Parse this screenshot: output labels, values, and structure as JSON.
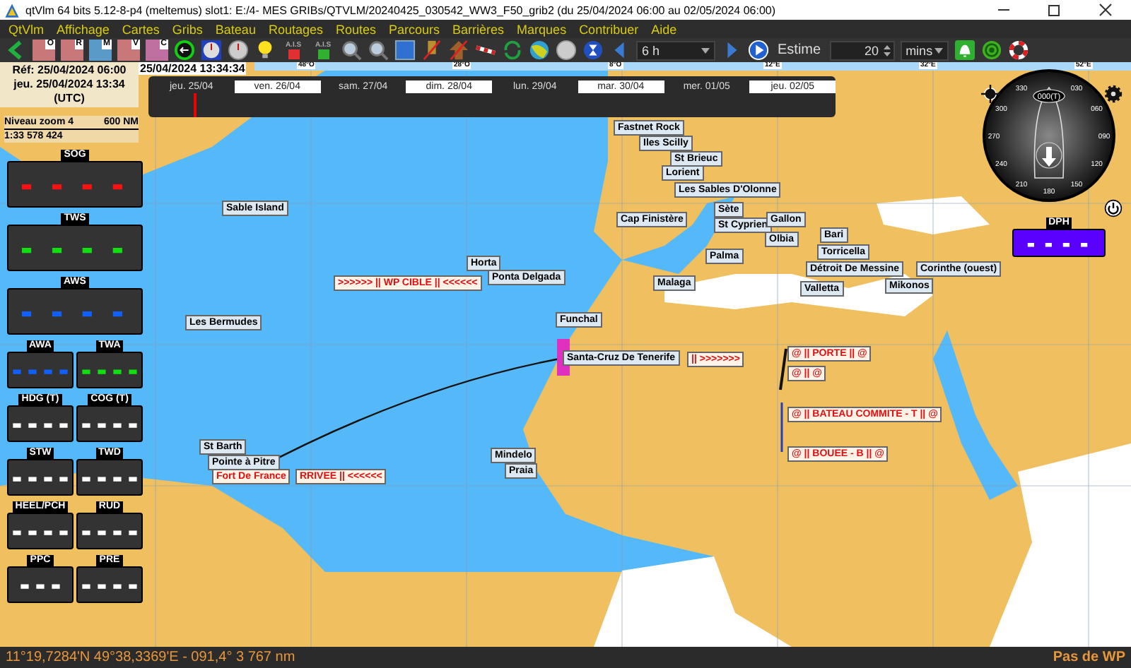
{
  "window": {
    "title": "qtVlm 64 bits 5.12-8-p4 (meltemus) slot1: E:/4- MES GRIBs/QTVLM/20240425_030542_WW3_F50_grib2 (du 25/04/2024 06:00 au 02/05/2024 06:00)"
  },
  "menu": [
    "QtVlm",
    "Affichage",
    "Cartes",
    "Gribs",
    "Bateau",
    "Routages",
    "Routes",
    "Parcours",
    "Barrières",
    "Marques",
    "Contribuer",
    "Aide"
  ],
  "toolbar": [
    {
      "kind": "back"
    },
    {
      "kind": "grib",
      "label": "O",
      "color": "#c87878"
    },
    {
      "kind": "grib",
      "label": "R",
      "color": "#c87878"
    },
    {
      "kind": "grib",
      "label": "M",
      "color": "#5a9ac8"
    },
    {
      "kind": "grib",
      "label": "V",
      "color": "#c87878"
    },
    {
      "kind": "grib",
      "label": "C",
      "color": "#c070a0"
    },
    {
      "kind": "circle-arrow"
    },
    {
      "kind": "clock-blue"
    },
    {
      "kind": "clock-grey"
    },
    {
      "kind": "bulb"
    },
    {
      "kind": "ais",
      "label": "A.I.S",
      "color": "#e03030"
    },
    {
      "kind": "ais",
      "label": "A.I.S",
      "color": "#30b030"
    },
    {
      "kind": "zoom-in"
    },
    {
      "kind": "zoom-out"
    },
    {
      "kind": "square"
    },
    {
      "kind": "flag-off"
    },
    {
      "kind": "arrow-off"
    },
    {
      "kind": "route"
    },
    {
      "kind": "recycle"
    },
    {
      "kind": "globe"
    },
    {
      "kind": "ball"
    },
    {
      "kind": "hourglass"
    },
    {
      "kind": "prev"
    },
    {
      "kind": "select",
      "value": "6 h"
    },
    {
      "kind": "next"
    },
    {
      "kind": "play"
    },
    {
      "kind": "text",
      "label": "Estime"
    },
    {
      "kind": "spin",
      "value": "20"
    },
    {
      "kind": "select",
      "value": "mins"
    },
    {
      "kind": "bell"
    },
    {
      "kind": "target"
    },
    {
      "kind": "lifebuoy"
    }
  ],
  "map": {
    "time_header": "25/04/2024 13:34:34",
    "ref_box": {
      "ref": "Réf: 25/04/2024 06:00",
      "now": "jeu. 25/04/2024 13:34",
      "zone": "(UTC)"
    },
    "longitudes": [
      "48°O",
      "28°O",
      "8°O",
      "12°E",
      "32°E",
      "52°E"
    ],
    "timeline": {
      "level": 0.065,
      "days": [
        "jeu. 25/04",
        "ven. 26/04",
        "sam. 27/04",
        "dim. 28/04",
        "lun. 29/04",
        "mar. 30/04",
        "mer. 01/05",
        "jeu. 02/05"
      ]
    },
    "zoom": {
      "level_label": "Niveau zoom 4",
      "scale": "600 NM",
      "ratio": "1:33 578 424"
    },
    "instruments": [
      {
        "label": "SOG",
        "value": "- - - -",
        "kind": "wide",
        "color": "#ff1010"
      },
      {
        "label": "TWS",
        "value": "- - - -",
        "kind": "wide",
        "color": "#10e010"
      },
      {
        "label": "AWS",
        "value": "- - - -",
        "kind": "wide",
        "color": "#1060ff"
      },
      {
        "label": "AWA",
        "value": "- - - -",
        "kind": "half",
        "color": "#1060ff"
      },
      {
        "label": "TWA",
        "value": "- - - -",
        "kind": "half",
        "color": "#10e010"
      },
      {
        "label": "HDG (T)",
        "value": "- - - -",
        "kind": "half",
        "color": "#ffffff"
      },
      {
        "label": "COG (T)",
        "value": "- - - -",
        "kind": "half",
        "color": "#ffffff"
      },
      {
        "label": "STW",
        "value": "- - - -",
        "kind": "half",
        "color": "#ffffff"
      },
      {
        "label": "TWD",
        "value": "- - - -",
        "kind": "half",
        "color": "#ffffff"
      },
      {
        "label": "HEEL/PCH",
        "value": "- - - -",
        "kind": "half",
        "color": "#ffffff"
      },
      {
        "label": "RUD",
        "value": "- - - -",
        "kind": "half",
        "color": "#ffffff"
      },
      {
        "label": "PPC",
        "value": "- - -",
        "kind": "half",
        "color": "#ffffff"
      },
      {
        "label": "PRE",
        "value": "- - - -",
        "kind": "half",
        "color": "#ffffff"
      }
    ],
    "depth": {
      "label": "DPH",
      "value": "- - - -"
    },
    "compass": {
      "heading": "000(T)",
      "ticks": [
        "030",
        "060",
        "090",
        "120",
        "150",
        "180",
        "210",
        "240",
        "270",
        "300",
        "330"
      ]
    },
    "places": [
      {
        "label": "Fastnet Rock",
        "kind": "place"
      },
      {
        "label": "Iles Scilly",
        "kind": "place"
      },
      {
        "label": "St Brieuc",
        "kind": "place"
      },
      {
        "label": "Lorient",
        "kind": "place"
      },
      {
        "label": "Les Sables D'Olonne",
        "kind": "place"
      },
      {
        "label": "Cap Finistère",
        "kind": "place"
      },
      {
        "label": "Sète",
        "kind": "place"
      },
      {
        "label": "St Cyprien",
        "kind": "place"
      },
      {
        "label": "Gallon",
        "kind": "place"
      },
      {
        "label": "Olbia",
        "kind": "place"
      },
      {
        "label": "Palma",
        "kind": "place"
      },
      {
        "label": "Bari",
        "kind": "place"
      },
      {
        "label": "Torricella",
        "kind": "place"
      },
      {
        "label": "Détroit De Messine",
        "kind": "place"
      },
      {
        "label": "Corinthe (ouest)",
        "kind": "place"
      },
      {
        "label": "Malaga",
        "kind": "place"
      },
      {
        "label": "Valletta",
        "kind": "place"
      },
      {
        "label": "Mikonos",
        "kind": "place"
      },
      {
        "label": "Sable Island",
        "kind": "place"
      },
      {
        "label": "Horta",
        "kind": "place"
      },
      {
        "label": "Ponta Delgada",
        "kind": "place"
      },
      {
        "label": ">>>>>> || WP CIBLE || <<<<<<",
        "kind": "mark"
      },
      {
        "label": "Les Bermudes",
        "kind": "place"
      },
      {
        "label": "Funchal",
        "kind": "place"
      },
      {
        "label": "Santa-Cruz De Tenerife",
        "kind": "place"
      },
      {
        "label": "|| >>>>>>>",
        "kind": "mark"
      },
      {
        "label": "@ || PORTE || @",
        "kind": "mark"
      },
      {
        "label": "@ || @",
        "kind": "mark"
      },
      {
        "label": "@ || BATEAU COMMITE - T || @",
        "kind": "mark"
      },
      {
        "label": "@ || BOUEE - B || @",
        "kind": "mark"
      },
      {
        "label": "St Barth",
        "kind": "place"
      },
      {
        "label": "Pointe à Pitre",
        "kind": "place"
      },
      {
        "label": "Fort De France",
        "kind": "mark"
      },
      {
        "label": "RRIVEE || <<<<<<",
        "kind": "mark"
      },
      {
        "label": "Mindelo",
        "kind": "place"
      },
      {
        "label": "Praia",
        "kind": "place"
      }
    ]
  },
  "status": {
    "position": "11°19,7284'N 49°38,3369'E - 091,4° 3 767 nm",
    "waypoint": "Pas de WP"
  }
}
